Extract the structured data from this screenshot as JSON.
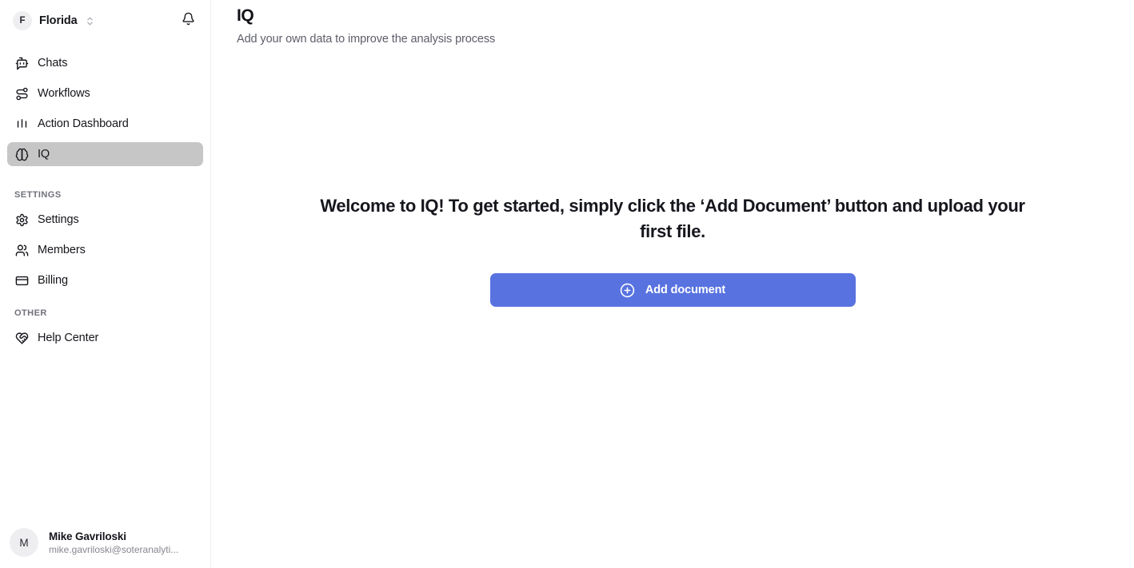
{
  "sidebar": {
    "org": {
      "avatar_initial": "F",
      "name": "Florida",
      "switch_icon": "chevrons-up-down-icon"
    },
    "notifications_icon": "bell-icon",
    "primary_nav": [
      {
        "label": "Chats",
        "icon": "bot-message-square-icon",
        "active": false
      },
      {
        "label": "Workflows",
        "icon": "workflow-route-icon",
        "active": false
      },
      {
        "label": "Action Dashboard",
        "icon": "bar-chart-icon",
        "active": false
      },
      {
        "label": "IQ",
        "icon": "brain-icon",
        "active": true
      }
    ],
    "settings_section": {
      "title": "SETTINGS",
      "items": [
        {
          "label": "Settings",
          "icon": "gear-icon"
        },
        {
          "label": "Members",
          "icon": "users-icon"
        },
        {
          "label": "Billing",
          "icon": "credit-card-icon"
        }
      ]
    },
    "other_section": {
      "title": "OTHER",
      "items": [
        {
          "label": "Help Center",
          "icon": "heart-handshake-icon"
        }
      ]
    },
    "user": {
      "avatar_initial": "M",
      "name": "Mike Gavriloski",
      "email": "mike.gavriloski@soteranalyti..."
    }
  },
  "main": {
    "title": "IQ",
    "subtitle": "Add your own data to improve the analysis process",
    "empty_state": {
      "message": "Welcome to IQ! To get started, simply click the ‘Add Document’ button and upload your first file.",
      "button_label": "Add document",
      "button_icon": "circle-plus-icon"
    }
  },
  "colors": {
    "accent": "#5872e0",
    "active_nav_bg": "#c6c6c6",
    "text_primary": "#15161b",
    "text_muted": "#70717c"
  }
}
